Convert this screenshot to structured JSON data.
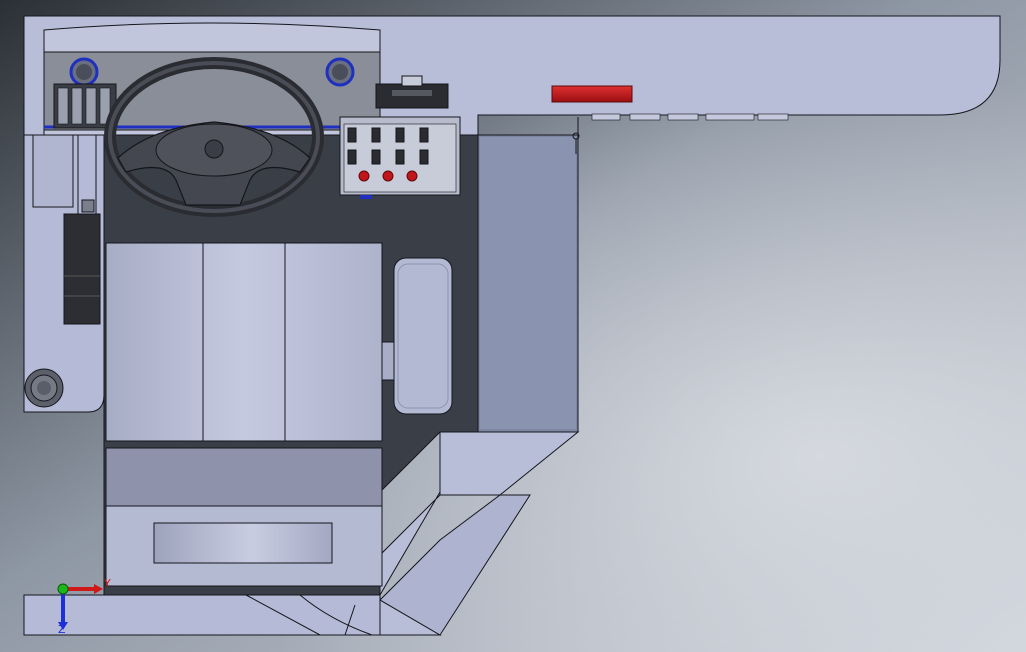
{
  "viewport": {
    "background_top": "#2f3439",
    "background_bottom": "#c9ced7",
    "model_face_color": "#b9bed8",
    "model_face_alt": "#a9aecb",
    "model_dark_floor": "#3b3f48",
    "edge_color": "#15161c",
    "accent_red": "#c2161b",
    "accent_blue": "#1f2fbf"
  },
  "triad": {
    "y_label": "Y",
    "z_label": "Z",
    "y_color": "#d01818",
    "z_color": "#1d2fd8",
    "x_color": "#18b818"
  },
  "parts": {
    "dashboard": "dashboard",
    "steering_wheel": "steering-wheel",
    "control_panel": "control-panel",
    "driver_seat": "driver-seat",
    "gear_lever": "gear-lever",
    "warning_light": "warning-light"
  }
}
